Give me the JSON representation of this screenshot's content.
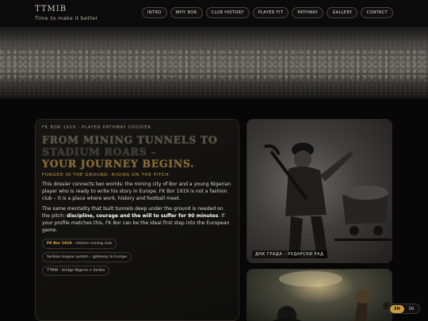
{
  "header": {
    "logo": "TTMIB",
    "tagline": "Time to make it better",
    "nav": [
      "INTRO",
      "WHY BOR",
      "CLUB HISTORY",
      "PLAYER FIT",
      "PATHWAY",
      "GALLERY",
      "CONTACT"
    ]
  },
  "dossier": {
    "kicker": "FK BOR 1919 · PLAYER PATHWAY DOSSIER",
    "headline": [
      "FROM MINING TUNNELS TO",
      "STADIUM ROARS –",
      "YOUR JOURNEY BEGINS."
    ],
    "subhead": "FORGED IN THE GROUND. RISING ON THE PITCH.",
    "para1": "This dossier connects two worlds: the mining city of Bor and a young Nigerian player who is ready to write his story in Europe. FK Bor 1919 is not a fashion club – it is a place where work, history and football meet.",
    "para2_prefix": "The same mentality that built tunnels deep under the ground is needed on the pitch: ",
    "para2_bold": "discipline, courage and the will to suffer for 90 minutes",
    "para2_suffix": ". If your profile matches this, FK Bor can be the ideal first step into the European game.",
    "chips": [
      {
        "highlight": "FK Bor 1919",
        "text": " – historic mining club"
      },
      {
        "highlight": "",
        "text": "Serbian league system – gateway to Europe"
      },
      {
        "highlight": "",
        "text": "TTMIB – bridge Nigeria ↔ Serbia"
      }
    ]
  },
  "photos": {
    "miner_caption": "ДНК ГРАДА – РУДАРСКИ РАД"
  },
  "language": {
    "options": [
      "EN",
      "SR"
    ],
    "active": "EN"
  },
  "colors": {
    "accent_gold": "#c69a3e",
    "background": "#070707"
  }
}
